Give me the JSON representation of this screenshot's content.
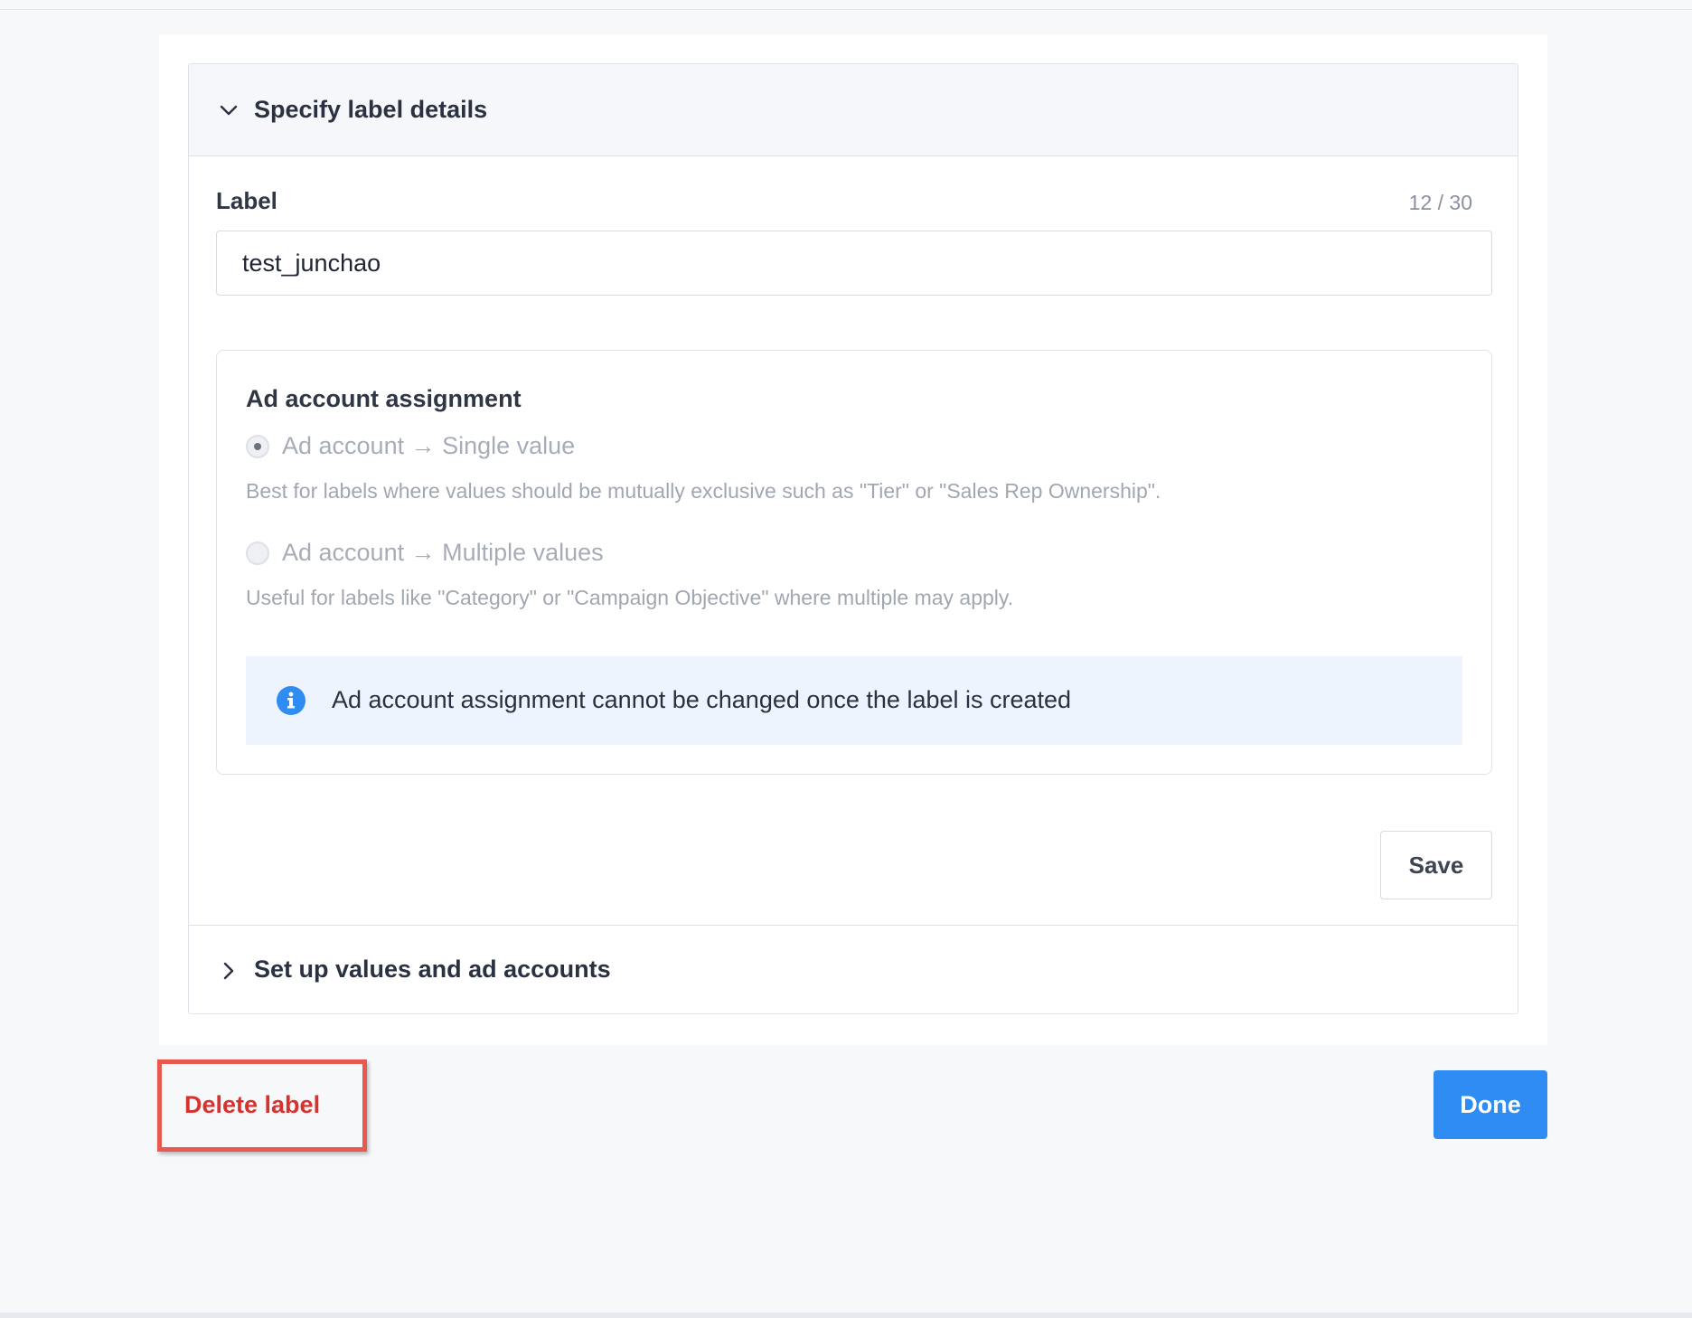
{
  "section_details": {
    "title": "Specify label details",
    "chevron_icon": "chevron-down-icon"
  },
  "label_field": {
    "label": "Label",
    "counter": "12 / 30",
    "value": "test_junchao"
  },
  "assignment": {
    "title": "Ad account assignment",
    "options": [
      {
        "label": "Ad account → Single value",
        "help": "Best for labels where values should be mutually exclusive such as \"Tier\" or \"Sales Rep Ownership\".",
        "checked": true
      },
      {
        "label": "Ad account → Multiple values",
        "help": "Useful for labels like \"Category\" or \"Campaign Objective\" where multiple may apply.",
        "checked": false
      }
    ],
    "info_icon": "info-circle-icon",
    "info_text": "Ad account assignment cannot be changed once the label is created"
  },
  "save_label": "Save",
  "section_values": {
    "title": "Set up values and ad accounts",
    "chevron_icon": "chevron-right-icon"
  },
  "delete_label": "Delete label",
  "done_label": "Done",
  "colors": {
    "primary": "#2f8cf3",
    "danger": "#d7322d",
    "highlight": "#e85a4f",
    "info_bg": "#edf4fd"
  }
}
